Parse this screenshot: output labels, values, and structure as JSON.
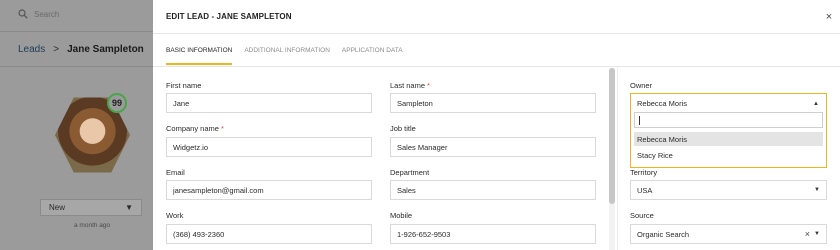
{
  "background": {
    "search_placeholder": "Search",
    "breadcrumb": {
      "root": "Leads",
      "separator": ">",
      "current": "Jane Sampleton"
    },
    "lead_score": "99",
    "status_value": "New",
    "status_caret": "▼",
    "last_activity": "a month ago"
  },
  "modal": {
    "title": "EDIT LEAD - JANE SAMPLETON",
    "close_glyph": "×",
    "tabs": [
      {
        "label": "BASIC INFORMATION",
        "active": true
      },
      {
        "label": "ADDITIONAL INFORMATION",
        "active": false
      },
      {
        "label": "APPLICATION DATA",
        "active": false
      }
    ],
    "fields": {
      "first_name": {
        "label": "First name",
        "value": "Jane"
      },
      "last_name": {
        "label": "Last name",
        "value": "Sampleton",
        "required": "*"
      },
      "company_name": {
        "label": "Company name",
        "value": "Widgetz.io",
        "required": "*"
      },
      "job_title": {
        "label": "Job title",
        "value": "Sales Manager"
      },
      "email": {
        "label": "Email",
        "value": "janesampleton@gmail.com"
      },
      "department": {
        "label": "Department",
        "value": "Sales"
      },
      "work": {
        "label": "Work",
        "value": "(368) 493-2360"
      },
      "mobile": {
        "label": "Mobile",
        "value": "1-926-652-9503"
      }
    },
    "owner": {
      "label": "Owner",
      "value": "Rebecca Moris",
      "caret": "▲",
      "options": [
        "Rebecca Moris",
        "Stacy Rice"
      ]
    },
    "territory": {
      "label": "Territory",
      "value": "USA",
      "caret": "▼"
    },
    "source": {
      "label": "Source",
      "value": "Organic Search",
      "clear": "×",
      "caret": "▼"
    }
  },
  "colors": {
    "accent": "#f3b51b",
    "required": "#e0473f",
    "score_ring": "#4aa54a"
  }
}
